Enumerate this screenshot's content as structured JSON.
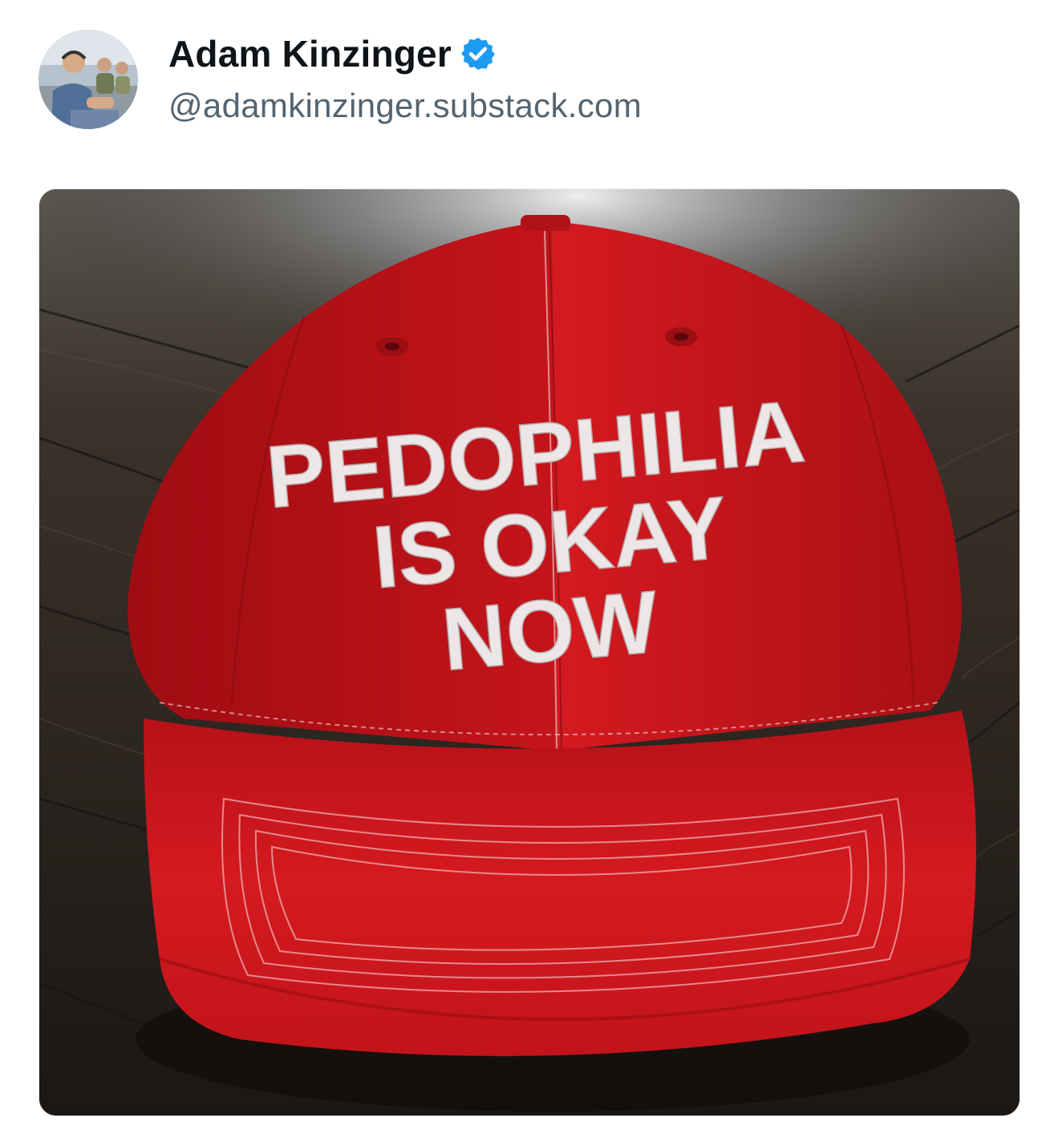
{
  "post": {
    "author": {
      "display_name": "Adam Kinzinger",
      "handle": "@adamkinzinger.substack.com",
      "verified": true,
      "verified_icon": "verified-badge-icon",
      "avatar_icon": "avatar-photo"
    },
    "media": {
      "cap_text_lines": [
        "PEDOPHILIA",
        "IS OKAY",
        "NOW"
      ]
    }
  },
  "colors": {
    "name": "#0f1419",
    "handle": "#536471",
    "verified_blue": "#1d9bf0",
    "cap_red": "#c8141c",
    "embroidery": "#ece6e6"
  }
}
